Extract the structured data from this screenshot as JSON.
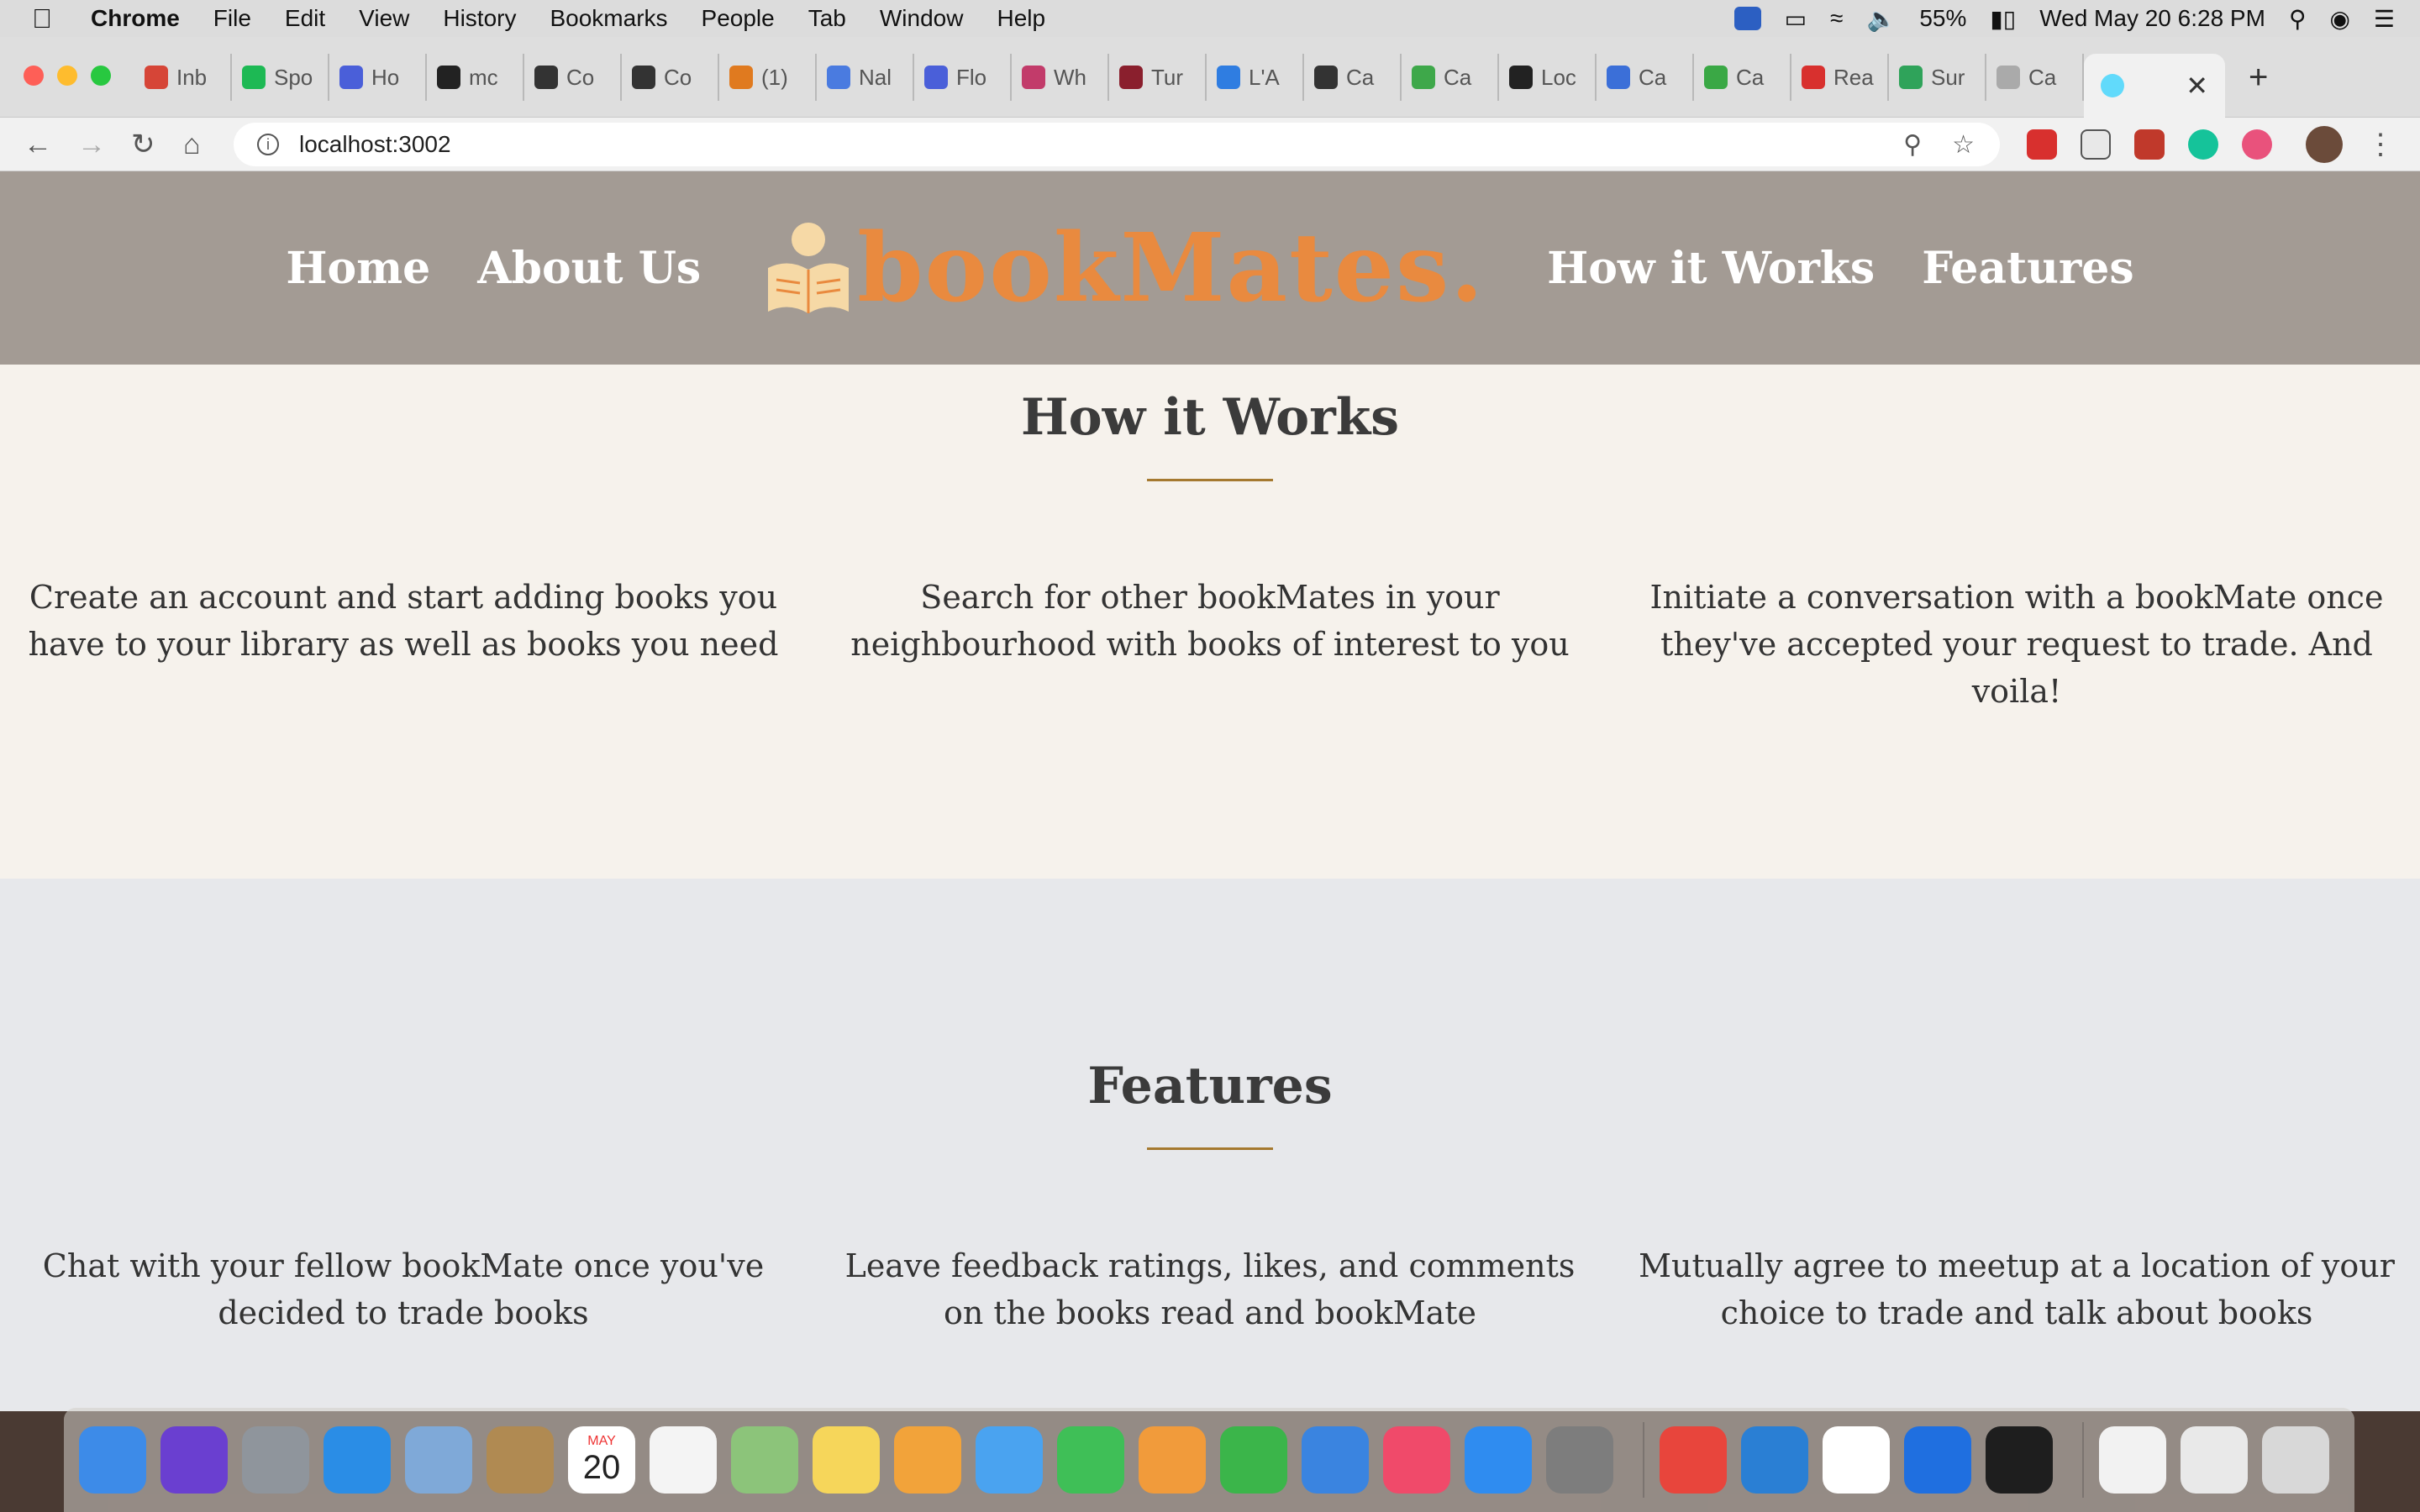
{
  "menubar": {
    "app_name": "Chrome",
    "items": [
      "File",
      "Edit",
      "View",
      "History",
      "Bookmarks",
      "People",
      "Tab",
      "Window",
      "Help"
    ],
    "battery": "55%",
    "datetime": "Wed May 20  6:28 PM"
  },
  "tabs": [
    {
      "label": "Inb",
      "color": "#d64537"
    },
    {
      "label": "Spo",
      "color": "#1db954"
    },
    {
      "label": "Ho",
      "color": "#4a5fd9"
    },
    {
      "label": "mc",
      "color": "#222222"
    },
    {
      "label": "Co",
      "color": "#333333"
    },
    {
      "label": "Co",
      "color": "#333333"
    },
    {
      "label": "(1)",
      "color": "#e07a1f"
    },
    {
      "label": "Nal",
      "color": "#4a7be0"
    },
    {
      "label": "Flo",
      "color": "#4a5fd9"
    },
    {
      "label": "Wh",
      "color": "#c23b6a"
    },
    {
      "label": "Tur",
      "color": "#8a1f2d"
    },
    {
      "label": "L'A",
      "color": "#2f7de1"
    },
    {
      "label": "Ca",
      "color": "#333333"
    },
    {
      "label": "Ca",
      "color": "#3ea84a"
    },
    {
      "label": "Loc",
      "color": "#222222"
    },
    {
      "label": "Ca",
      "color": "#3b6fd8"
    },
    {
      "label": "Ca",
      "color": "#3aa845"
    },
    {
      "label": "Rea",
      "color": "#d8302e"
    },
    {
      "label": "Sur",
      "color": "#2fa35a"
    },
    {
      "label": "Ca",
      "color": "#aaaaaa"
    }
  ],
  "omnibox": {
    "url": "localhost:3002"
  },
  "site": {
    "nav_left": [
      "Home",
      "About Us"
    ],
    "logo_text": "bookMates.",
    "nav_right": [
      "How it Works",
      "Features"
    ],
    "how_it_works": {
      "title": "How it Works",
      "items": [
        "Create an account and start adding books you have to your library as well as books you need",
        "Search for other bookMates in your neighbourhood with books of interest to you",
        "Initiate a conversation with a bookMate once they've accepted your request to trade. And voila!"
      ]
    },
    "features": {
      "title": "Features",
      "items": [
        "Chat with your fellow bookMate once you've decided to trade books",
        "Leave feedback ratings, likes, and comments on the books read and bookMate",
        "Mutually agree to meetup at a location of your choice to trade and talk about books"
      ]
    }
  },
  "dock": {
    "calendar_month": "MAY",
    "calendar_day": "20",
    "apps": [
      {
        "name": "finder-icon",
        "color": "#3d8be8"
      },
      {
        "name": "siri-icon",
        "color": "#6a3fd0"
      },
      {
        "name": "launchpad-icon",
        "color": "#8f959c"
      },
      {
        "name": "safari-icon",
        "color": "#2a8de6"
      },
      {
        "name": "mail-icon",
        "color": "#7fa9d8"
      },
      {
        "name": "contacts-icon",
        "color": "#b08a52"
      },
      {
        "name": "calendar-icon",
        "color": "#ffffff"
      },
      {
        "name": "reminders-icon",
        "color": "#f4f4f4"
      },
      {
        "name": "maps-icon",
        "color": "#8cc47a"
      },
      {
        "name": "notes-icon",
        "color": "#f6d65a"
      },
      {
        "name": "photos-icon",
        "color": "#f2a33a"
      },
      {
        "name": "messages-icon",
        "color": "#4aa3f0"
      },
      {
        "name": "facetime-icon",
        "color": "#3fbf57"
      },
      {
        "name": "pages-icon",
        "color": "#f19b3b"
      },
      {
        "name": "numbers-icon",
        "color": "#3bb54a"
      },
      {
        "name": "keynote-icon",
        "color": "#3a84e0"
      },
      {
        "name": "music-icon",
        "color": "#f04a6a"
      },
      {
        "name": "app-store-icon",
        "color": "#2f8cf0"
      },
      {
        "name": "system-preferences-icon",
        "color": "#7d7d7d"
      },
      {
        "name": "chrome-icon",
        "color": "#e8453c"
      },
      {
        "name": "vscode-icon",
        "color": "#2a7fd4"
      },
      {
        "name": "slack-icon",
        "color": "#ffffff"
      },
      {
        "name": "teamviewer-icon",
        "color": "#1f6fe0"
      },
      {
        "name": "terminal-icon",
        "color": "#1e1e1e"
      }
    ],
    "recents": [
      {
        "name": "recent-document-icon",
        "color": "#f2f2f2"
      },
      {
        "name": "recent-chrome-window-icon",
        "color": "#e9e9e9"
      },
      {
        "name": "trash-icon",
        "color": "#d8d8d8"
      }
    ]
  }
}
